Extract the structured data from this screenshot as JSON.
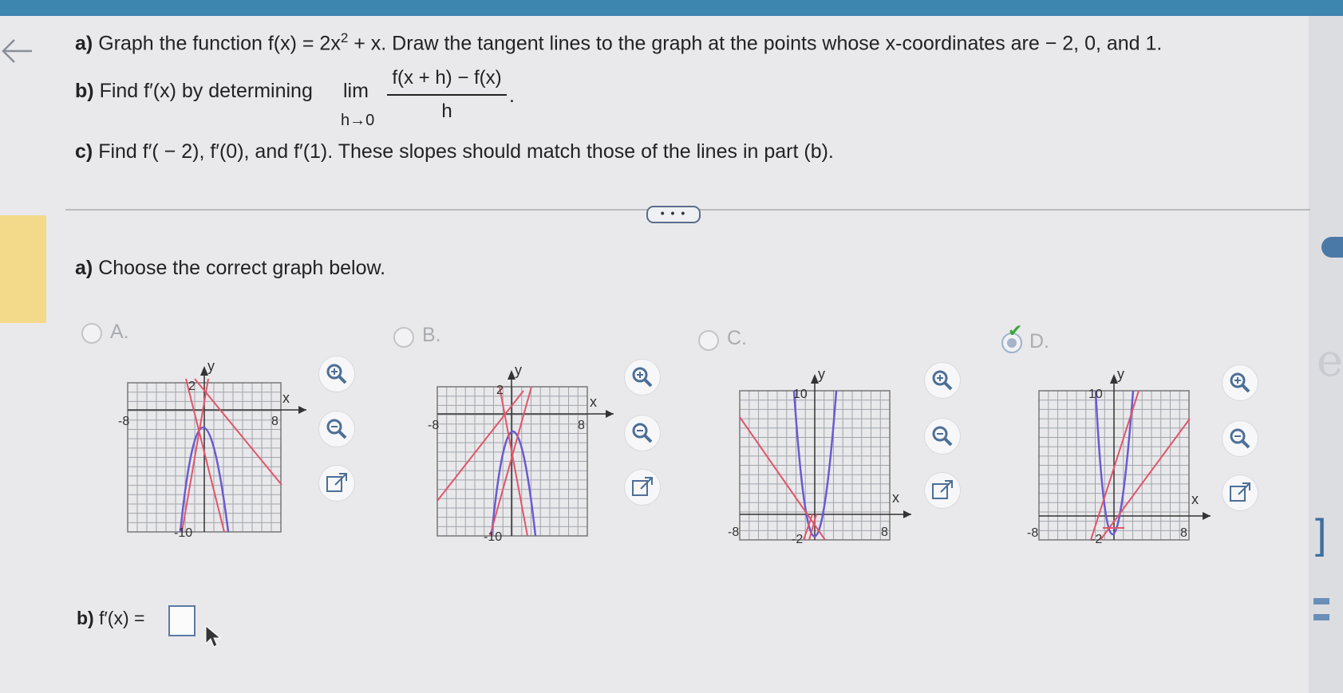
{
  "question": {
    "part_a_prefix": "a)",
    "part_a_text": "Graph the function f(x) = 2x",
    "part_a_exp": "2",
    "part_a_rest": "+ x. Draw the tangent lines to the graph at the points whose x-coordinates are − 2, 0, and 1.",
    "part_b_prefix": "b)",
    "part_b_text": "Find f′(x) by determining",
    "part_b_lim": "lim",
    "part_b_sub": "h→0",
    "part_b_num": "f(x + h) − f(x)",
    "part_b_den": "h",
    "part_b_end": ".",
    "part_c_prefix": "c)",
    "part_c_text": "Find f′( − 2), f′(0), and f′(1). These slopes should match those of the lines in part (b)."
  },
  "more_button": "• • •",
  "sub_a": {
    "prefix": "a)",
    "text": "Choose the correct graph below."
  },
  "choices": [
    {
      "label": "A.",
      "selected": false,
      "axis_labels": {
        "y": "y",
        "x": "x",
        "top": "2",
        "left": "-8",
        "right": "8",
        "bottom": "-10"
      }
    },
    {
      "label": "B.",
      "selected": false,
      "axis_labels": {
        "y": "y",
        "x": "x",
        "top": "2",
        "left": "-8",
        "right": "8",
        "bottom": "-10"
      }
    },
    {
      "label": "C.",
      "selected": false,
      "axis_labels": {
        "y": "y",
        "x": "x",
        "top": "10",
        "left": "-8",
        "right": "8",
        "bottom": "-2"
      }
    },
    {
      "label": "D.",
      "selected": true,
      "axis_labels": {
        "y": "y",
        "x": "x",
        "top": "10",
        "left": "-8",
        "right": "8",
        "bottom": "-2"
      }
    }
  ],
  "tools": {
    "zoom_in": "zoom-in-icon",
    "zoom_out": "zoom-out-icon",
    "popout": "external-link-icon"
  },
  "sub_b": {
    "prefix": "b)",
    "text": "f′(x) ="
  },
  "colors": {
    "curve": "#6a5bd0",
    "tangent": "#e0566a",
    "grid": "#a0a4aa",
    "accent": "#3d86b0"
  }
}
